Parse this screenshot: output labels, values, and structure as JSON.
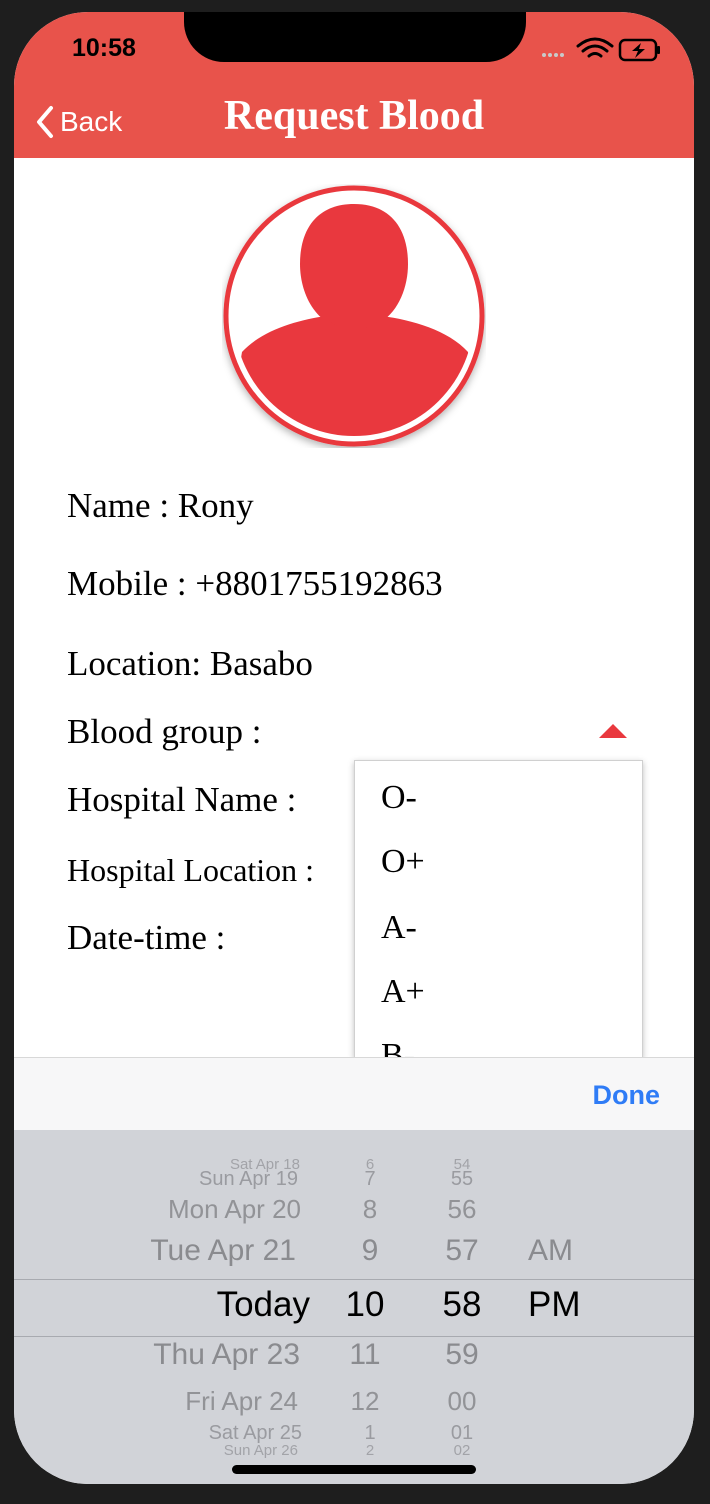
{
  "status_bar": {
    "time": "10:58"
  },
  "nav": {
    "back_label": "Back",
    "title": "Request Blood"
  },
  "form": {
    "name": "Name : Rony",
    "mobile": "Mobile : +8801755192863",
    "location": "Location: Basabo",
    "blood_group": "Blood group :",
    "hospital_name": "Hospital Name :",
    "hospital_location": "Hospital Location :",
    "date_time": "Date-time :"
  },
  "blood_group_options": [
    "O-",
    "O+",
    "A-",
    "A+",
    "B-"
  ],
  "toolbar": {
    "done_label": "Done"
  },
  "picker": {
    "dates": [
      "Sat Apr 18",
      "Sun Apr 19",
      "Mon Apr 20",
      "Tue Apr 21",
      "Today",
      "Thu Apr 23",
      "Fri Apr 24",
      "Sat Apr 25",
      "Sun Apr 26"
    ],
    "hours": [
      "6",
      "7",
      "8",
      "9",
      "10",
      "11",
      "12",
      "1",
      "2"
    ],
    "minutes": [
      "54",
      "55",
      "56",
      "57",
      "58",
      "59",
      "00",
      "01",
      "02"
    ],
    "ampm_above": "AM",
    "ampm_selected": "PM",
    "selected": {
      "date": "Today",
      "hour": "10",
      "minute": "58",
      "ampm": "PM"
    }
  },
  "colors": {
    "accent": "#e8534b",
    "avatar_red": "#e9383e",
    "link_blue": "#2f7cf6",
    "picker_bg": "#d1d3d8"
  },
  "icons": [
    "back-chevron-icon",
    "wifi-icon",
    "battery-charging-icon",
    "cellular-signal-icon",
    "user-avatar-icon",
    "dropdown-caret-icon"
  ]
}
